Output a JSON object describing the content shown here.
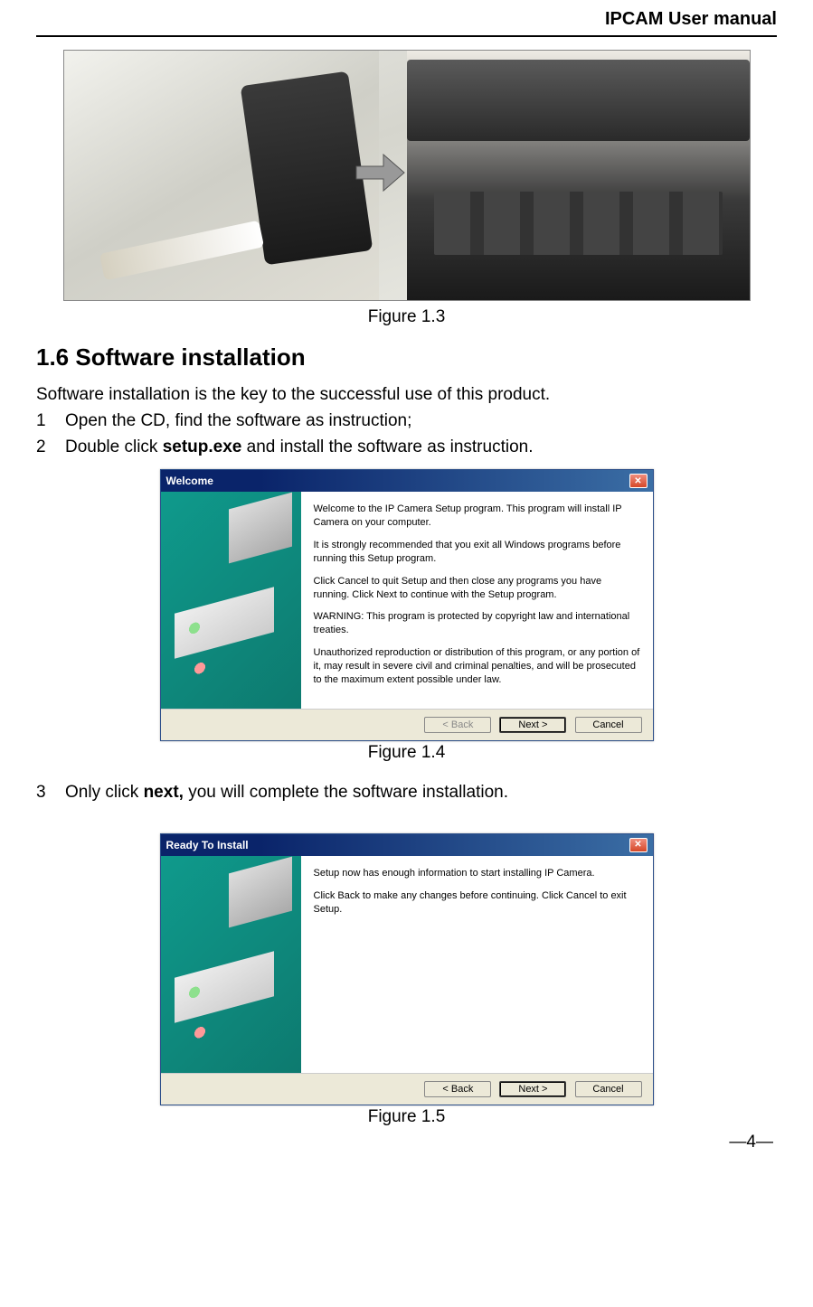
{
  "header": {
    "title": "IPCAM User manual"
  },
  "figure1_3": {
    "caption": "Figure 1.3"
  },
  "section": {
    "heading": "1.6 Software installation",
    "intro": "Software installation is the key to the successful use of this product.",
    "steps": [
      {
        "num": "1",
        "pre": "Open the CD, find the software as instruction;"
      },
      {
        "num": "2",
        "pre": "Double click ",
        "bold": "setup.exe",
        "post": " and install the software as instruction."
      },
      {
        "num": "3",
        "pre": "Only click ",
        "bold": "next,",
        "post": " you will complete the software installation."
      }
    ]
  },
  "dialog1": {
    "title": "Welcome",
    "paragraphs": [
      "Welcome to the IP Camera Setup program. This program will install IP Camera on your computer.",
      "It is strongly recommended that you exit all Windows programs before running this Setup program.",
      "Click Cancel to quit Setup and then close any programs you have running. Click Next to continue with the Setup program.",
      "WARNING: This program is protected by copyright law and international treaties.",
      "Unauthorized reproduction or distribution of this program, or any portion of it, may result in severe civil and criminal penalties, and will be prosecuted to the maximum extent possible under law."
    ],
    "buttons": {
      "back": "< Back",
      "next": "Next >",
      "cancel": "Cancel"
    },
    "caption": "Figure 1.4"
  },
  "dialog2": {
    "title": "Ready To Install",
    "paragraphs": [
      "Setup now has enough information to start installing IP Camera.",
      "Click Back to make any changes before continuing. Click Cancel to exit Setup."
    ],
    "buttons": {
      "back": "< Back",
      "next": "Next >",
      "cancel": "Cancel"
    },
    "caption": "Figure 1.5"
  },
  "footer": {
    "page": "—4—"
  }
}
